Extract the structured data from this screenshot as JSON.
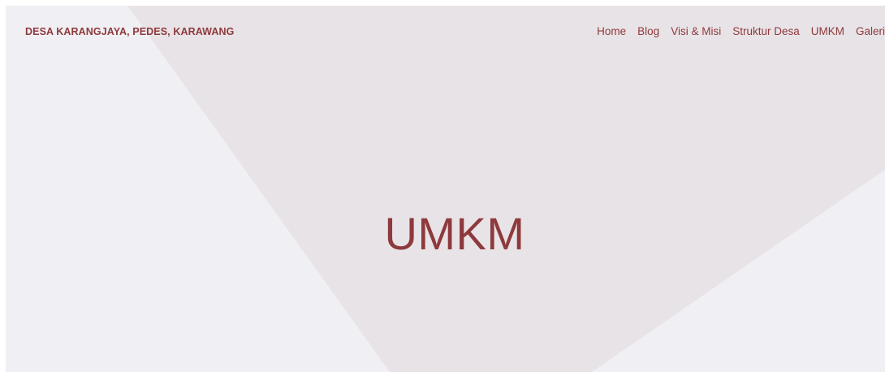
{
  "header": {
    "site_title": "DESA KARANGJAYA, PEDES, KARAWANG",
    "nav": [
      {
        "label": "Home"
      },
      {
        "label": "Blog"
      },
      {
        "label": "Visi & Misi"
      },
      {
        "label": "Struktur Desa"
      },
      {
        "label": "UMKM"
      },
      {
        "label": "Galeri"
      }
    ]
  },
  "hero": {
    "title": "UMKM"
  },
  "colors": {
    "accent": "#8e3a3c",
    "background": "#f0eff3",
    "shape": "#e8e3e7"
  }
}
